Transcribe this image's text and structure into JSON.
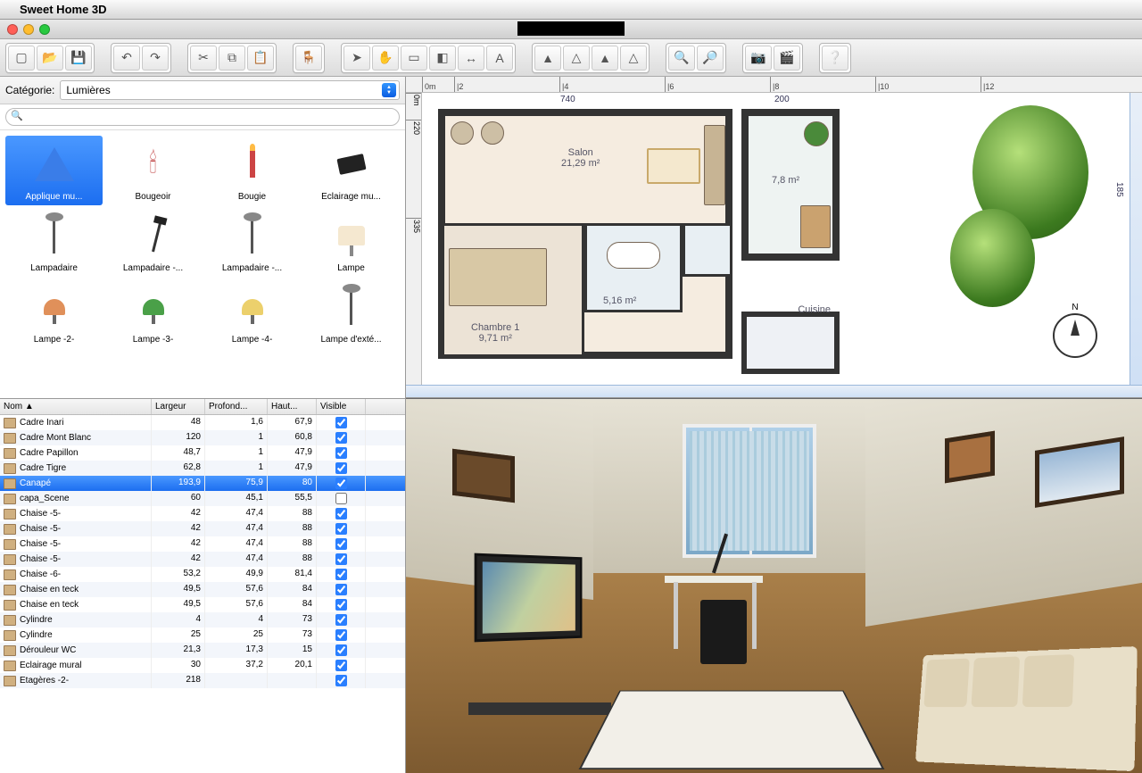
{
  "menubar": {
    "app_name": "Sweet Home 3D"
  },
  "window": {
    "title": ""
  },
  "toolbar": {
    "groups": [
      [
        "new-file-icon",
        "open-file-icon",
        "save-file-icon"
      ],
      [
        "undo-icon",
        "redo-icon"
      ],
      [
        "cut-icon",
        "copy-icon",
        "paste-icon"
      ],
      [
        "add-furniture-icon"
      ],
      [
        "select-icon",
        "pan-icon",
        "create-walls-icon",
        "create-rooms-icon",
        "create-dimensions-icon",
        "create-text-icon"
      ],
      [
        "plan-scale-1-icon",
        "plan-scale-2-icon",
        "plan-scale-3-icon",
        "plan-scale-4-icon"
      ],
      [
        "zoom-in-icon",
        "zoom-out-icon"
      ],
      [
        "create-photo-icon",
        "create-video-icon"
      ],
      [
        "help-icon"
      ]
    ],
    "glyphs": {
      "new-file-icon": "▢",
      "open-file-icon": "📂",
      "save-file-icon": "💾",
      "undo-icon": "↶",
      "redo-icon": "↷",
      "cut-icon": "✂",
      "copy-icon": "⧉",
      "paste-icon": "📋",
      "add-furniture-icon": "🪑",
      "select-icon": "➤",
      "pan-icon": "✋",
      "create-walls-icon": "▭",
      "create-rooms-icon": "◧",
      "create-dimensions-icon": "↔",
      "create-text-icon": "A",
      "plan-scale-1-icon": "▲",
      "plan-scale-2-icon": "△",
      "plan-scale-3-icon": "▲",
      "plan-scale-4-icon": "△",
      "zoom-in-icon": "🔍",
      "zoom-out-icon": "🔎",
      "create-photo-icon": "📷",
      "create-video-icon": "🎬",
      "help-icon": "❔"
    }
  },
  "catalog": {
    "category_label": "Catégorie:",
    "category_value": "Lumières",
    "search_placeholder": "",
    "items": [
      {
        "name": "Applique mu...",
        "icon": "sconce",
        "selected": true
      },
      {
        "name": "Bougeoir",
        "icon": "candelabra"
      },
      {
        "name": "Bougie",
        "icon": "candle"
      },
      {
        "name": "Eclairage mu...",
        "icon": "spot"
      },
      {
        "name": "Lampadaire",
        "icon": "floorlamp"
      },
      {
        "name": "Lampadaire -...",
        "icon": "flex"
      },
      {
        "name": "Lampadaire -...",
        "icon": "floorlamp"
      },
      {
        "name": "Lampe",
        "icon": "shade"
      },
      {
        "name": "Lampe -2-",
        "icon": "desk",
        "color": "#e0905a"
      },
      {
        "name": "Lampe -3-",
        "icon": "desk",
        "color": "#4aa048"
      },
      {
        "name": "Lampe -4-",
        "icon": "desk",
        "color": "#ecd06c"
      },
      {
        "name": "Lampe d'exté...",
        "icon": "floorlamp"
      }
    ]
  },
  "furniture": {
    "columns": [
      "Nom ▲",
      "Largeur",
      "Profond...",
      "Haut...",
      "Visible"
    ],
    "rows": [
      {
        "name": "Cadre Inari",
        "w": "48",
        "d": "1,6",
        "h": "67,9",
        "v": true
      },
      {
        "name": "Cadre Mont Blanc",
        "w": "120",
        "d": "1",
        "h": "60,8",
        "v": true
      },
      {
        "name": "Cadre Papillon",
        "w": "48,7",
        "d": "1",
        "h": "47,9",
        "v": true
      },
      {
        "name": "Cadre Tigre",
        "w": "62,8",
        "d": "1",
        "h": "47,9",
        "v": true
      },
      {
        "name": "Canapé",
        "w": "193,9",
        "d": "75,9",
        "h": "80",
        "v": true,
        "selected": true
      },
      {
        "name": "capa_Scene",
        "w": "60",
        "d": "45,1",
        "h": "55,5",
        "v": false
      },
      {
        "name": "Chaise -5-",
        "w": "42",
        "d": "47,4",
        "h": "88",
        "v": true
      },
      {
        "name": "Chaise -5-",
        "w": "42",
        "d": "47,4",
        "h": "88",
        "v": true
      },
      {
        "name": "Chaise -5-",
        "w": "42",
        "d": "47,4",
        "h": "88",
        "v": true
      },
      {
        "name": "Chaise -5-",
        "w": "42",
        "d": "47,4",
        "h": "88",
        "v": true
      },
      {
        "name": "Chaise -6-",
        "w": "53,2",
        "d": "49,9",
        "h": "81,4",
        "v": true
      },
      {
        "name": "Chaise en teck",
        "w": "49,5",
        "d": "57,6",
        "h": "84",
        "v": true
      },
      {
        "name": "Chaise en teck",
        "w": "49,5",
        "d": "57,6",
        "h": "84",
        "v": true
      },
      {
        "name": "Cylindre",
        "w": "4",
        "d": "4",
        "h": "73",
        "v": true
      },
      {
        "name": "Cylindre",
        "w": "25",
        "d": "25",
        "h": "73",
        "v": true
      },
      {
        "name": "Dérouleur WC",
        "w": "21,3",
        "d": "17,3",
        "h": "15",
        "v": true
      },
      {
        "name": "Eclairage mural",
        "w": "30",
        "d": "37,2",
        "h": "20,1",
        "v": true
      },
      {
        "name": "Etagères -2-",
        "w": "218",
        "d": "",
        "h": "",
        "v": true
      }
    ]
  },
  "plan": {
    "ruler_h": [
      "0m",
      "|2",
      "|4",
      "|6",
      "|8",
      "|10",
      "|12"
    ],
    "ruler_v": [
      "0m",
      "220",
      "335"
    ],
    "dims_top": [
      "740",
      "200"
    ],
    "dim_side": "185",
    "rooms": [
      {
        "name": "Salon",
        "area": "21,29 m²"
      },
      {
        "name": "Chambre 1",
        "area": "9,71 m²"
      },
      {
        "name": "",
        "area": "5,16 m²"
      },
      {
        "name": "",
        "area": "7,8 m²"
      },
      {
        "name": "Cuisine",
        "area": ""
      }
    ],
    "compass": "N"
  }
}
